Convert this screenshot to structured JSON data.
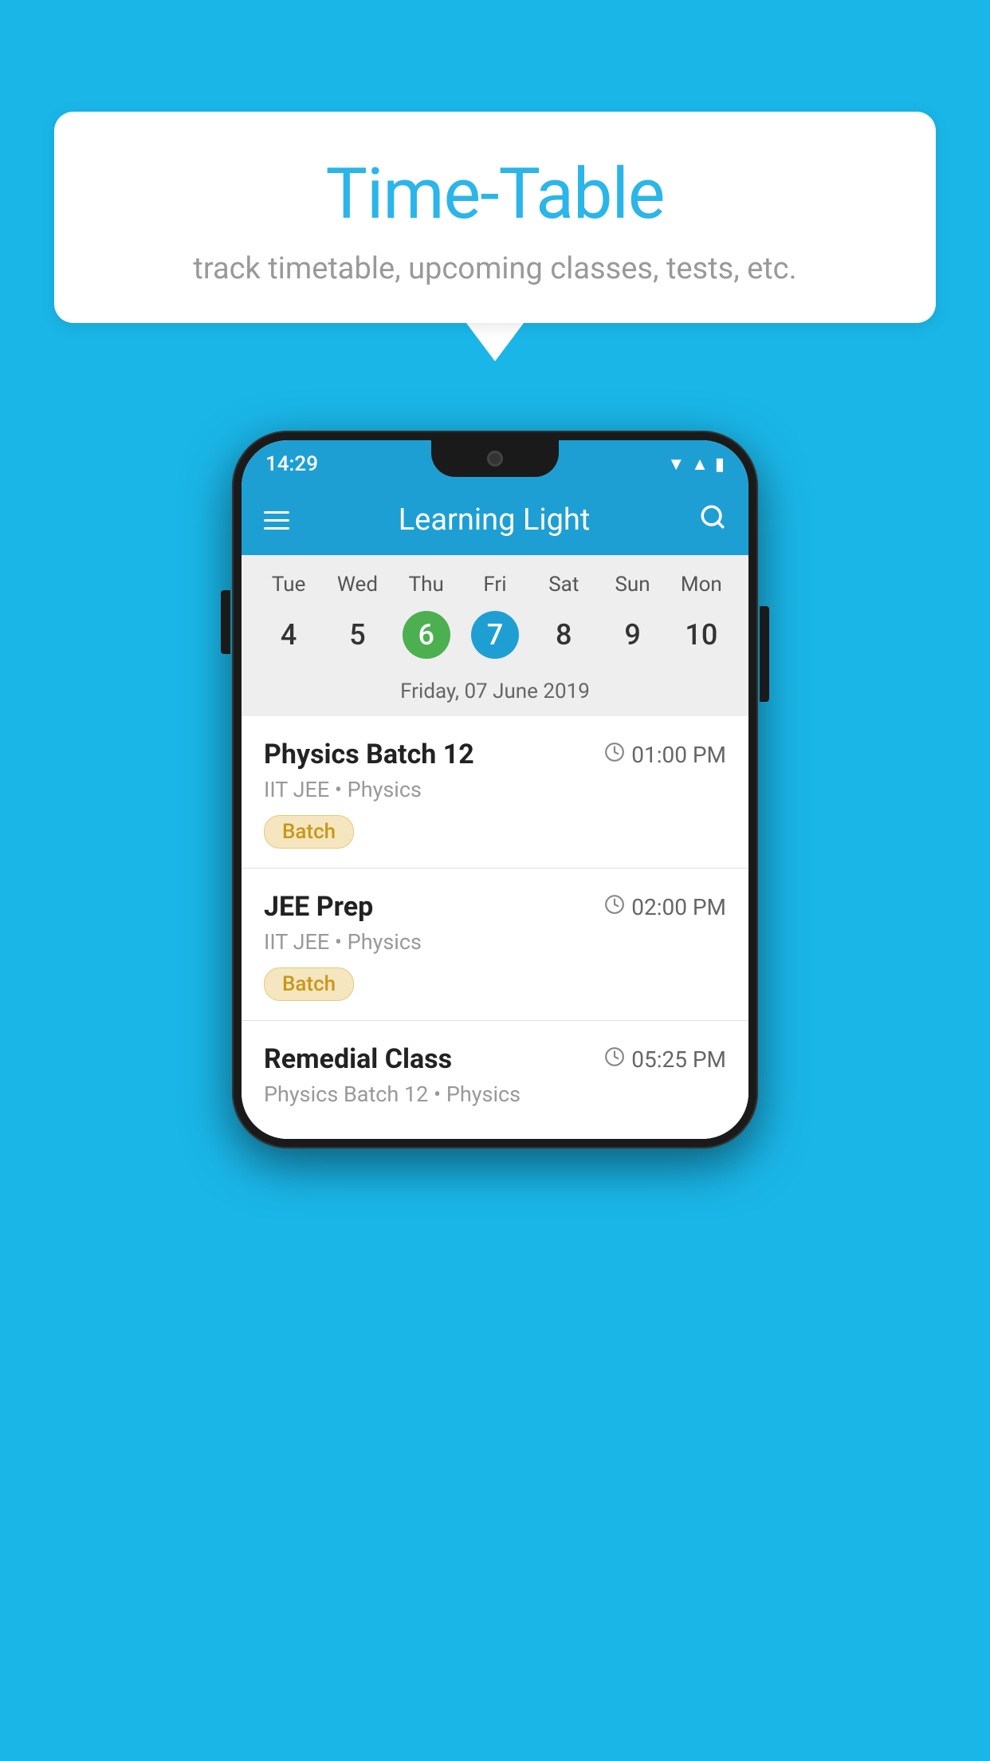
{
  "background_color": "#1ab6e8",
  "speech_bubble": {
    "title": "Time-Table",
    "subtitle": "track timetable, upcoming classes, tests, etc."
  },
  "phone": {
    "status_bar": {
      "time": "14:29"
    },
    "app_header": {
      "title": "Learning Light",
      "menu_icon": "hamburger-icon",
      "search_icon": "search-icon"
    },
    "calendar": {
      "days": [
        "Tue",
        "Wed",
        "Thu",
        "Fri",
        "Sat",
        "Sun",
        "Mon"
      ],
      "dates": [
        {
          "num": "4",
          "state": "normal"
        },
        {
          "num": "5",
          "state": "normal"
        },
        {
          "num": "6",
          "state": "today"
        },
        {
          "num": "7",
          "state": "selected"
        },
        {
          "num": "8",
          "state": "normal"
        },
        {
          "num": "9",
          "state": "normal"
        },
        {
          "num": "10",
          "state": "normal"
        }
      ],
      "selected_date_label": "Friday, 07 June 2019"
    },
    "schedule_items": [
      {
        "title": "Physics Batch 12",
        "time": "01:00 PM",
        "detail": "IIT JEE • Physics",
        "tag": "Batch"
      },
      {
        "title": "JEE Prep",
        "time": "02:00 PM",
        "detail": "IIT JEE • Physics",
        "tag": "Batch"
      },
      {
        "title": "Remedial Class",
        "time": "05:25 PM",
        "detail": "Physics Batch 12 • Physics",
        "tag": ""
      }
    ]
  }
}
